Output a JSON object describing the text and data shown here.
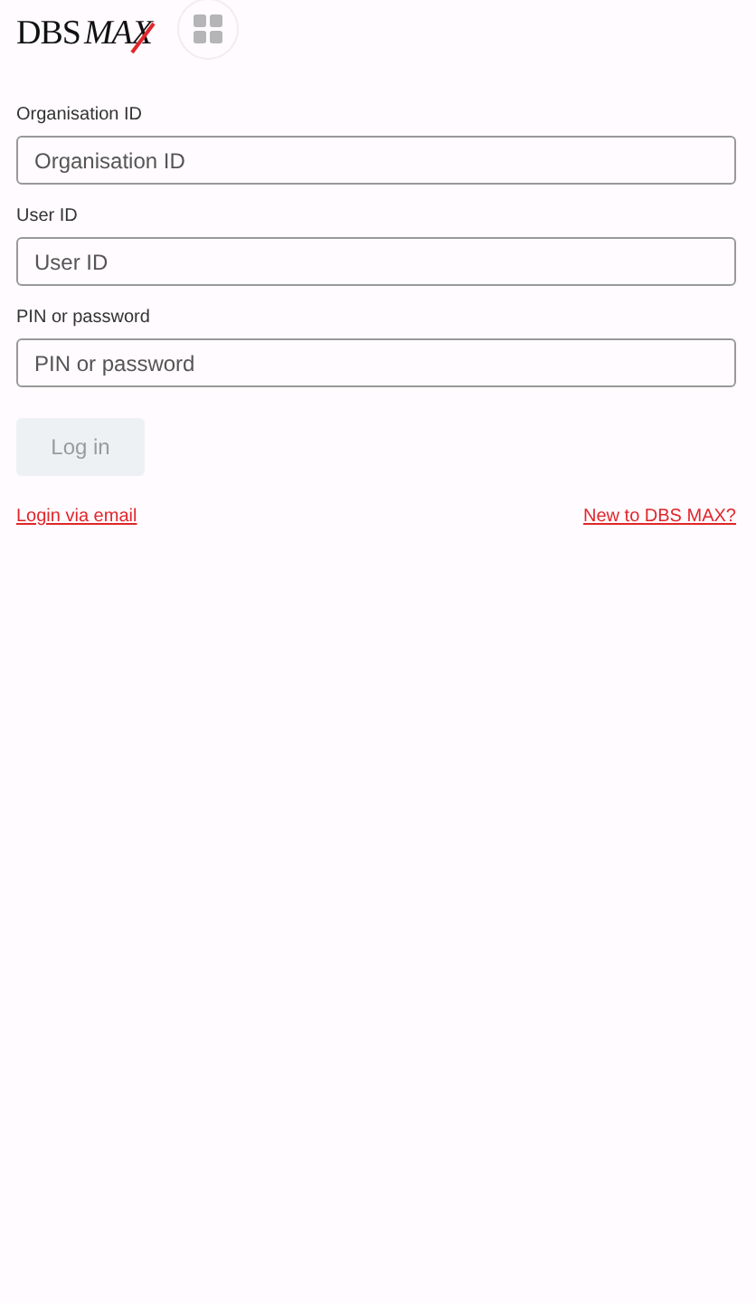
{
  "logo": {
    "brand": "DBS",
    "product": "MAX"
  },
  "fields": [
    {
      "label": "Organisation ID",
      "placeholder": "Organisation ID"
    },
    {
      "label": "User ID",
      "placeholder": "User ID"
    },
    {
      "label": "PIN or password",
      "placeholder": "PIN or password"
    }
  ],
  "login_button": {
    "label": "Log in",
    "disabled": true
  },
  "links": [
    "Login via email",
    "New to DBS MAX?"
  ]
}
